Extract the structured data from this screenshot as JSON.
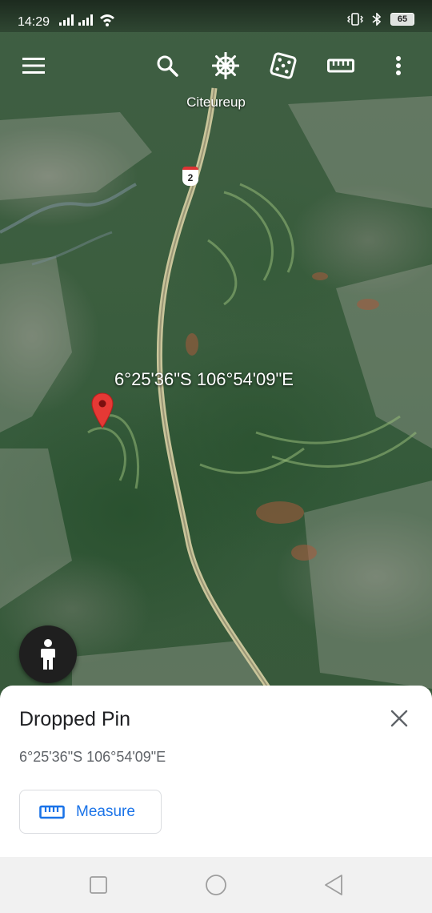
{
  "status_bar": {
    "time": "14:29",
    "battery": "65"
  },
  "toolbar": {
    "icons": [
      "menu-icon",
      "search-icon",
      "voyager-wheel-icon",
      "feeling-lucky-dice-icon",
      "measure-ruler-icon",
      "more-vert-icon"
    ]
  },
  "map": {
    "place_label": "Citeureup",
    "road_shield": "2",
    "coordinate_label": "6°25'36\"S 106°54'09\"E",
    "pin_color": "#e53935"
  },
  "sheet": {
    "title": "Dropped Pin",
    "coordinates": "6°25'36\"S 106°54'09\"E",
    "measure_label": "Measure",
    "accent": "#1a73e8"
  },
  "nav_bar": {
    "icons": [
      "recents-square-icon",
      "home-circle-icon",
      "back-triangle-icon"
    ]
  }
}
